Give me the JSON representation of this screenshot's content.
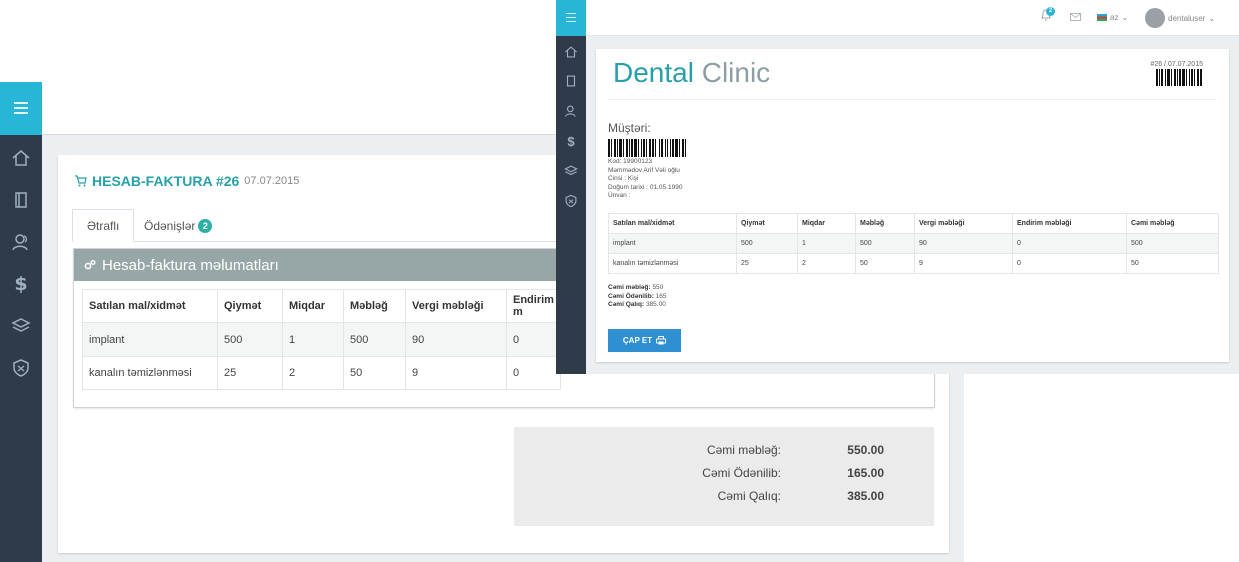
{
  "back": {
    "invoice_title": "HESAB-FAKTURA #26",
    "invoice_date": "07.07.2015",
    "tabs": [
      {
        "label": "Ətraflı"
      },
      {
        "label": "Ödənişlər",
        "badge": "2"
      }
    ],
    "panel_title": "Hesab-faktura məlumatları",
    "table": {
      "headers": [
        "Satılan mal/xidmət",
        "Qiymət",
        "Miqdar",
        "Məbləğ",
        "Vergi məbləği",
        "Endirim m"
      ],
      "rows": [
        [
          "implant",
          "500",
          "1",
          "500",
          "90",
          "0"
        ],
        [
          "kanalın təmizlənməsi",
          "25",
          "2",
          "50",
          "9",
          "0"
        ]
      ]
    },
    "summary": {
      "total_label": "Cəmi məbləğ:",
      "total_value": "550.00",
      "paid_label": "Cəmi Ödənilib:",
      "paid_value": "165.00",
      "due_label": "Cəmi Qalıq:",
      "due_value": "385.00"
    }
  },
  "front": {
    "topbar": {
      "notification_count": "2",
      "language": "az",
      "username": "dentaluser"
    },
    "brand_primary": "Dental",
    "brand_secondary": "Clinic",
    "invoice_ref": "#26 / 07.07.2015",
    "customer_heading": "Müştəri:",
    "customer": {
      "code": "Kod: 19900123",
      "name": "Məmmədov Arif Vəli oğlu",
      "gender": "Cinsi : Kişi",
      "birth": "Doğum tarixi : 01.05.1990",
      "address": "Ünvan :"
    },
    "table": {
      "headers": [
        "Satılan mal/xidmət",
        "Qiymət",
        "Miqdar",
        "Məbləğ",
        "Vergi məbləği",
        "Endirim məbləği",
        "Cəmi məbləğ"
      ],
      "rows": [
        [
          "implant",
          "500",
          "1",
          "500",
          "90",
          "0",
          "500"
        ],
        [
          "kanalın təmizlənməsi",
          "25",
          "2",
          "50",
          "9",
          "0",
          "50"
        ]
      ]
    },
    "totals": {
      "total_label": "Cəmi məbləğ:",
      "total_value": "550",
      "paid_label": "Cəmi Ödənilib:",
      "paid_value": "165",
      "due_label": "Cəmi Qalıq:",
      "due_value": "385.00"
    },
    "print_button": "ÇAP ET"
  },
  "colors": {
    "accent": "#27b6d6",
    "sidebar": "#2f3b48",
    "brand": "#27a0a8",
    "panel_header": "#97a6a6",
    "button": "#2e8fd1"
  },
  "icons": [
    "menu-icon",
    "home-icon",
    "book-icon",
    "users-icon",
    "dollar-icon",
    "layers-icon",
    "shield-icon",
    "cart-icon",
    "cogs-icon",
    "bell-icon",
    "mail-icon",
    "flag-icon",
    "print-icon"
  ]
}
